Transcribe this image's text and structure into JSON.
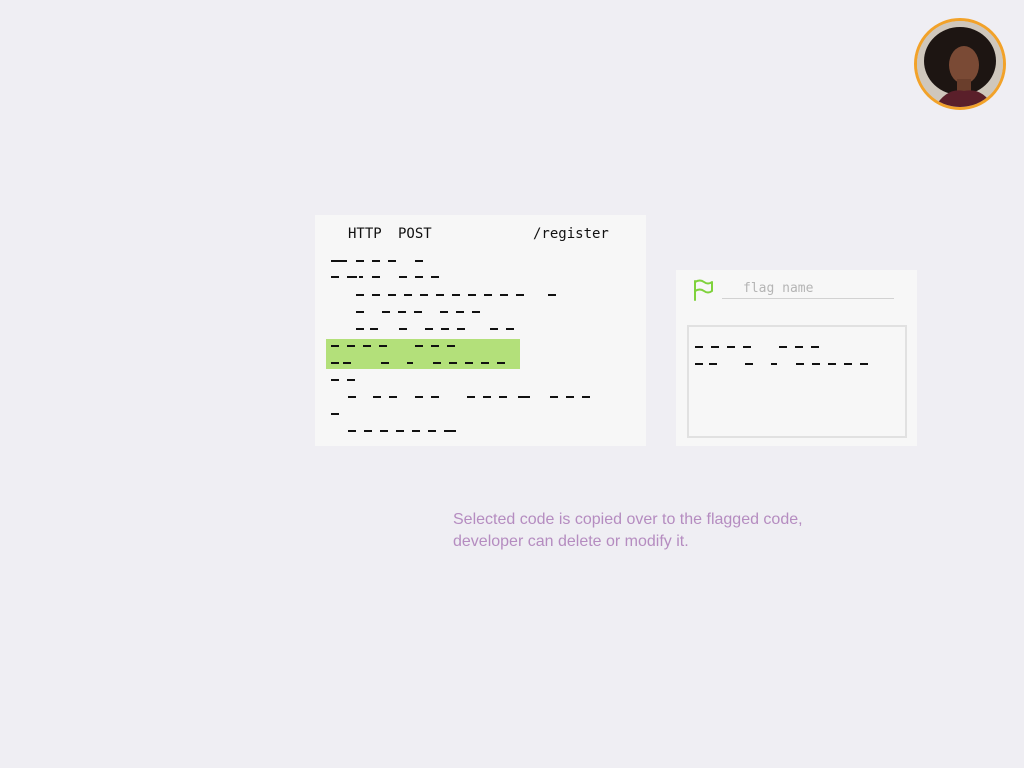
{
  "user": {
    "avatar_icon": "user-avatar",
    "border_color": "#f2a229"
  },
  "editor": {
    "method": "HTTP",
    "verb": "POST",
    "path": "/register",
    "highlight_color": "#b3e07a"
  },
  "flag": {
    "icon": "flag-icon",
    "icon_color": "#7fd23c",
    "placeholder": "flag name",
    "value": ""
  },
  "note": {
    "line1": "Selected code is copied over to the flagged code,",
    "line2": "developer can delete or modify it."
  }
}
